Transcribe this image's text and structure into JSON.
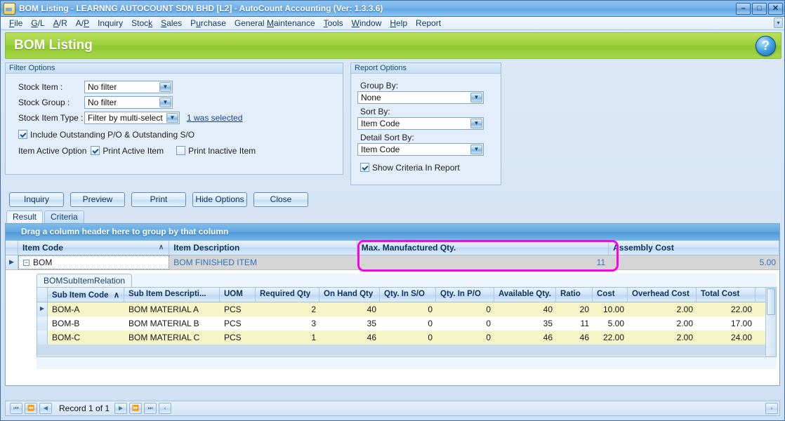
{
  "window": {
    "title": "BOM Listing - LEARNNG AUTOCOUNT SDN BHD [L2] - AutoCount Accounting (Ver: 1.3.3.6)",
    "minimize_label": "–",
    "maximize_label": "□",
    "close_label": "✕",
    "app_icon": "document-icon"
  },
  "menu": {
    "items": [
      {
        "label": "File"
      },
      {
        "label": "G/L"
      },
      {
        "label": "A/R"
      },
      {
        "label": "A/P"
      },
      {
        "label": "Inquiry"
      },
      {
        "label": "Stock"
      },
      {
        "label": "Sales"
      },
      {
        "label": "Purchase"
      },
      {
        "label": "General Maintenance"
      },
      {
        "label": "Tools"
      },
      {
        "label": "Window"
      },
      {
        "label": "Help"
      },
      {
        "label": "Report"
      }
    ],
    "scroll_glyph": "▾"
  },
  "header": {
    "title": "BOM Listing",
    "help_label": "?"
  },
  "filter_options": {
    "caption": "Filter Options",
    "stock_item": {
      "label": "Stock Item :",
      "value": "No filter"
    },
    "stock_group": {
      "label": "Stock Group :",
      "value": "No filter"
    },
    "stock_item_type": {
      "label": "Stock Item Type :",
      "value": "Filter by multi-select",
      "link": "1 was selected"
    },
    "include_outstanding": {
      "label": "Include Outstanding P/O & Outstanding S/O",
      "checked": true
    },
    "item_active_option": {
      "label": "Item Active Option",
      "print_active": {
        "label": "Print Active Item",
        "checked": true
      },
      "print_inactive": {
        "label": "Print Inactive Item",
        "checked": false
      }
    }
  },
  "report_options": {
    "caption": "Report Options",
    "group_by": {
      "label": "Group By:",
      "value": "None"
    },
    "sort_by": {
      "label": "Sort By:",
      "value": "Item Code"
    },
    "detail_sort_by": {
      "label": "Detail Sort By:",
      "value": "Item Code"
    },
    "show_criteria": {
      "label": "Show Criteria In Report",
      "checked": true
    }
  },
  "buttons": [
    {
      "label": "Inquiry"
    },
    {
      "label": "Preview"
    },
    {
      "label": "Print"
    },
    {
      "label": "Hide Options"
    },
    {
      "label": "Close"
    }
  ],
  "tabs": [
    {
      "label": "Result",
      "active": true
    },
    {
      "label": "Criteria",
      "active": false
    }
  ],
  "grid": {
    "group_panel_text": "Drag a column header here to group by that column",
    "columns": [
      {
        "label": "Item Code",
        "sorted": true,
        "sort_glyph": "∧"
      },
      {
        "label": "Item Description"
      },
      {
        "label": "Max. Manufactured Qty."
      },
      {
        "label": "Assembly Cost"
      }
    ],
    "master_row": {
      "expander": "−",
      "item_code": "BOM",
      "item_description": "BOM FINISHED ITEM",
      "max_manufactured_qty": "11",
      "assembly_cost": "5.00",
      "row_indicator": "▶"
    },
    "highlight_color": "#ff00e4"
  },
  "detail": {
    "tab_label": "BOMSubItemRelation",
    "columns": [
      {
        "label": "Sub Item Code",
        "sorted": true,
        "sort_glyph": "∧"
      },
      {
        "label": "Sub Item Descripti..."
      },
      {
        "label": "UOM"
      },
      {
        "label": "Required Qty"
      },
      {
        "label": "On Hand Qty"
      },
      {
        "label": "Qty. In S/O"
      },
      {
        "label": "Qty. In P/O"
      },
      {
        "label": "Available Qty."
      },
      {
        "label": "Ratio"
      },
      {
        "label": "Cost"
      },
      {
        "label": "Overhead Cost"
      },
      {
        "label": "Total Cost"
      }
    ],
    "rows": [
      {
        "indicator": "▶",
        "sub_item_code": "BOM-A",
        "sub_item_description": "BOM MATERIAL A",
        "uom": "PCS",
        "required_qty": "2",
        "on_hand_qty": "40",
        "qty_in_so": "0",
        "qty_in_po": "0",
        "available_qty": "40",
        "ratio": "20",
        "cost": "10.00",
        "overhead_cost": "2.00",
        "total_cost": "22.00"
      },
      {
        "indicator": "",
        "sub_item_code": "BOM-B",
        "sub_item_description": "BOM MATERIAL B",
        "uom": "PCS",
        "required_qty": "3",
        "on_hand_qty": "35",
        "qty_in_so": "0",
        "qty_in_po": "0",
        "available_qty": "35",
        "ratio": "11",
        "cost": "5.00",
        "overhead_cost": "2.00",
        "total_cost": "17.00"
      },
      {
        "indicator": "",
        "sub_item_code": "BOM-C",
        "sub_item_description": "BOM MATERIAL C",
        "uom": "PCS",
        "required_qty": "1",
        "on_hand_qty": "46",
        "qty_in_so": "0",
        "qty_in_po": "0",
        "available_qty": "46",
        "ratio": "46",
        "cost": "22.00",
        "overhead_cost": "2.00",
        "total_cost": "24.00"
      }
    ]
  },
  "statusbar": {
    "first_label": "⏮",
    "prev_page_label": "⏪",
    "prev_label": "◀",
    "record_text": "Record 1 of 1",
    "next_label": "▶",
    "next_page_label": "⏩",
    "last_label": "⏭",
    "collapse_label": "‹",
    "expand_label": "›"
  }
}
